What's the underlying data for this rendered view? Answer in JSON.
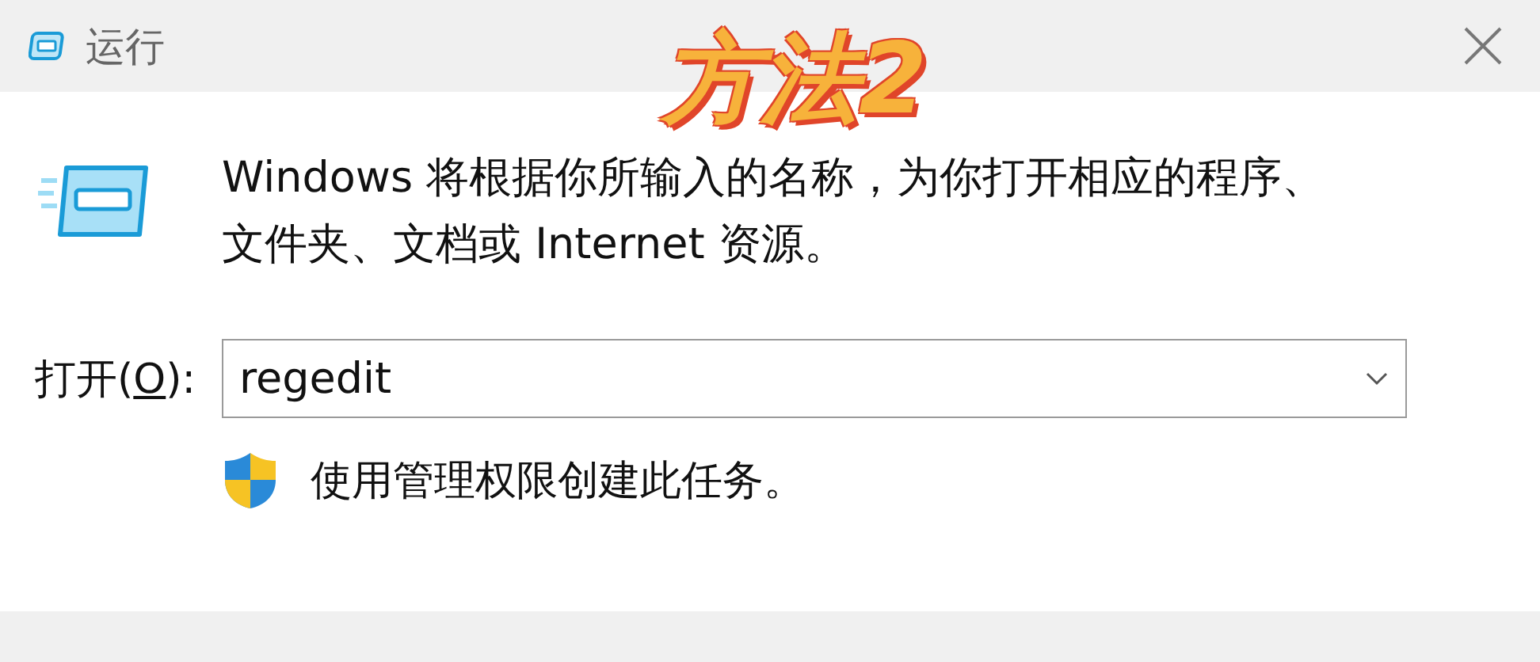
{
  "window": {
    "title": "运行"
  },
  "overlay_caption": "方法2",
  "description": "Windows 将根据你所输入的名称，为你打开相应的程序、文件夹、文档或 Internet 资源。",
  "open_field": {
    "label": [
      {
        "text": "打开(",
        "underlined": false
      },
      {
        "text": "O",
        "underlined": true
      },
      {
        "text": "):",
        "underlined": false
      }
    ],
    "value": "regedit"
  },
  "admin_note": "使用管理权限创建此任务。"
}
